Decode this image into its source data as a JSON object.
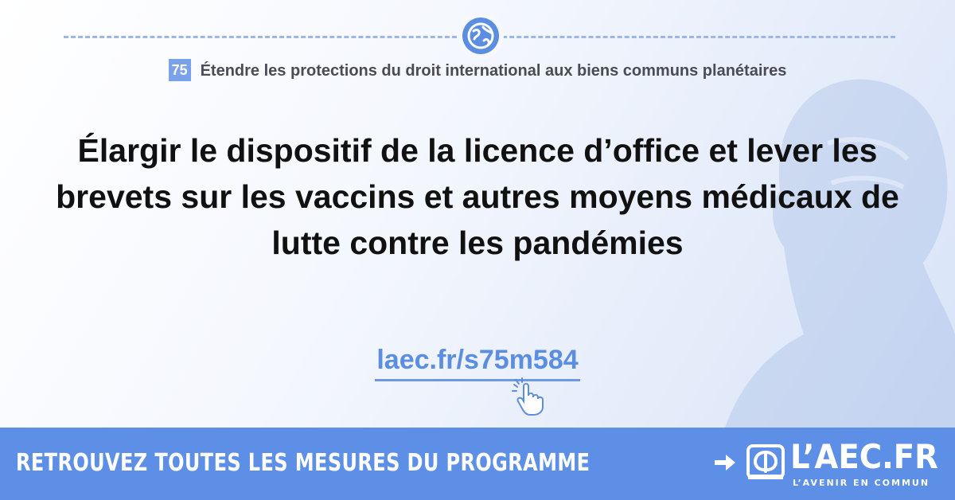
{
  "section": {
    "number": "75",
    "title": "Étendre les protections du droit international aux biens communs planétaires"
  },
  "headline": "Élargir le dispositif de la licence d’office et lever les brevets sur les vaccins et autres moyens médicaux de lutte contre les pandémies",
  "link": {
    "label": "laec.fr/s75m584"
  },
  "banner": {
    "cta": "RETROUVEZ TOUTES LES MESURES DU PROGRAMME",
    "logo_text": "L’AEC.FR",
    "logo_tagline": "L’AVENIR EN COMMUN"
  },
  "colors": {
    "accent": "#5d8fe6",
    "text": "#111111"
  },
  "icons": [
    "globe-icon",
    "pointer-hand-icon",
    "arrow-right-icon",
    "logo-icon"
  ]
}
